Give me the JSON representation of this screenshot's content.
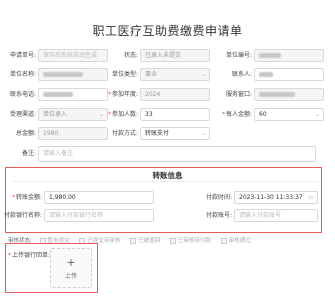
{
  "title": "职工医疗互助费缴费申请单",
  "row1": {
    "apply_no_label": "申请单号:",
    "apply_no_placeholder": "保存后系统自动生成",
    "status_label": "状态:",
    "status_value": "已录入未提交",
    "unit_no_label": "单位编号:"
  },
  "row2": {
    "unit_name_label": "单位名称:",
    "unit_type_label": "单位类型:",
    "unit_type_value": "事业",
    "contact_label": "联系人:"
  },
  "row3": {
    "phone_label": "联系电话:",
    "year_label": "参加年度:",
    "year_value": "2024",
    "window_label": "服务窗口:"
  },
  "row4": {
    "channel_label": "受理渠道:",
    "channel_value": "单位录入",
    "count_label": "参加人数:",
    "count_value": "33",
    "per_amount_label": "每人金额:",
    "per_amount_value": "60"
  },
  "row5": {
    "total_label": "总金额:",
    "total_value": "1980",
    "pay_label": "付款方式:",
    "pay_value": "转账支付"
  },
  "row6": {
    "remark_label": "备注:",
    "remark_placeholder": "请输入备注"
  },
  "transfer": {
    "section_title": "转账信息",
    "amount_label": "转账金额:",
    "amount_value": "1,980.00",
    "time_label": "付款时间:",
    "time_value": "2023-11-30 11:33:37",
    "payer_label": "付款银行名称:",
    "payer_placeholder": "请输入付款银行名称",
    "account_label": "付款账号:",
    "account_placeholder": "请输入付款账号"
  },
  "status_row": {
    "label": "审核状态:",
    "options": [
      "暂未提交",
      "已提交待审核",
      "已被退回",
      "已审核待付款",
      "审核通过"
    ]
  },
  "upload": {
    "label": "上传银行回单:",
    "plus": "+",
    "text": "上传"
  },
  "colors": {
    "highlight": "#e85a5a",
    "required": "#e5484d"
  }
}
